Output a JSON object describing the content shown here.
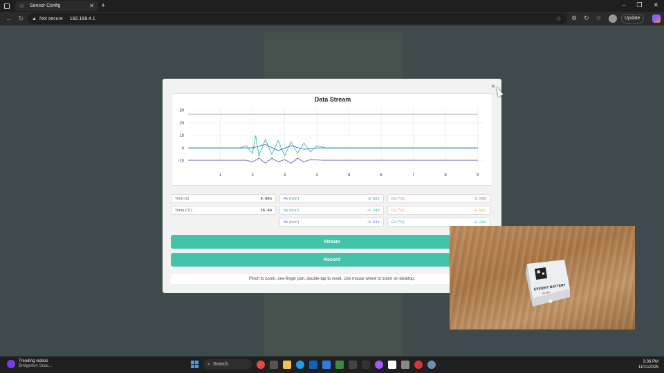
{
  "browser": {
    "tab_title": "Sensor Config",
    "security_label": "Not secure",
    "url": "192.168.4.1",
    "update_label": "Update"
  },
  "modal": {
    "close_glyph": "×",
    "hint": "Pinch to zoom, one-finger pan, double-tap to reset. Use mouse wheel to zoom on desktop.",
    "stream_label": "Stream",
    "record_label": "Record"
  },
  "readings": {
    "time": {
      "label": "Time (s)",
      "value": "9.003"
    },
    "temp": {
      "label": "Temp (°C)",
      "value": "26.90"
    },
    "ax": {
      "label": "Ax (m/s²)",
      "value": "0.022",
      "color": "#3a7bd5"
    },
    "ay": {
      "label": "Ay (m/s²)",
      "value": "-0.346",
      "color": "#43b3a0"
    },
    "az": {
      "label": "Az (m/s²)",
      "value": "-9.644",
      "color": "#7b68c8"
    },
    "gx": {
      "label": "Gx (°/s)",
      "value": "0.000",
      "color": "#e05a4f"
    },
    "gy": {
      "label": "Gy (°/s)",
      "value": "-0.001",
      "color": "#e8a23a"
    },
    "gz": {
      "label": "Gz (°/s)",
      "value": "-0.000",
      "color": "#43c4aa"
    }
  },
  "chart_data": {
    "type": "line",
    "title": "Data Stream",
    "xlim": [
      0,
      9.2
    ],
    "ylim": [
      -14,
      32
    ],
    "x_ticks": [
      "1",
      "2",
      "3",
      "4",
      "5",
      "6",
      "7",
      "8",
      "9"
    ],
    "y_ticks": [
      "30",
      "20",
      "10",
      "0",
      "-10"
    ],
    "grid": true,
    "series": [
      {
        "color": "#b8b0b0",
        "values": [
          [
            0,
            26.9
          ],
          [
            9.0,
            26.9
          ]
        ]
      },
      {
        "color": "#43c4aa",
        "values": [
          [
            0,
            0
          ],
          [
            1.6,
            0
          ],
          [
            1.8,
            2
          ],
          [
            2.0,
            -4
          ],
          [
            2.1,
            10
          ],
          [
            2.2,
            -6
          ],
          [
            2.4,
            7
          ],
          [
            2.6,
            -5
          ],
          [
            2.8,
            6
          ],
          [
            3.0,
            -6
          ],
          [
            3.2,
            5
          ],
          [
            3.4,
            -4
          ],
          [
            3.6,
            4
          ],
          [
            3.8,
            -3
          ],
          [
            4.0,
            2
          ],
          [
            4.3,
            0
          ],
          [
            9.0,
            0
          ]
        ]
      },
      {
        "color": "#7b68c8",
        "values": [
          [
            0,
            -9.6
          ],
          [
            1.8,
            -9.6
          ],
          [
            2.0,
            -11
          ],
          [
            2.2,
            -8
          ],
          [
            2.4,
            -12
          ],
          [
            2.6,
            -8
          ],
          [
            2.8,
            -11
          ],
          [
            3.0,
            -9
          ],
          [
            3.2,
            -12
          ],
          [
            3.4,
            -8
          ],
          [
            3.6,
            -11
          ],
          [
            3.8,
            -9
          ],
          [
            4.2,
            -9.6
          ],
          [
            9.0,
            -9.6
          ]
        ]
      },
      {
        "color": "#3a7bd5",
        "values": [
          [
            0,
            0.2
          ],
          [
            2.0,
            0.2
          ],
          [
            2.4,
            3
          ],
          [
            2.8,
            -2
          ],
          [
            3.2,
            2
          ],
          [
            3.6,
            -1
          ],
          [
            4.0,
            0.2
          ],
          [
            9.0,
            0.2
          ]
        ]
      }
    ]
  },
  "photo": {
    "device_text": "EVIDENT BATTERY",
    "device_sub": "ON OFF"
  },
  "taskbar": {
    "trend_title": "Trending videos",
    "trend_sub": "Bridgerton Seas...",
    "search_label": "Search",
    "time": "3:36 PM",
    "date": "11/11/2025"
  }
}
